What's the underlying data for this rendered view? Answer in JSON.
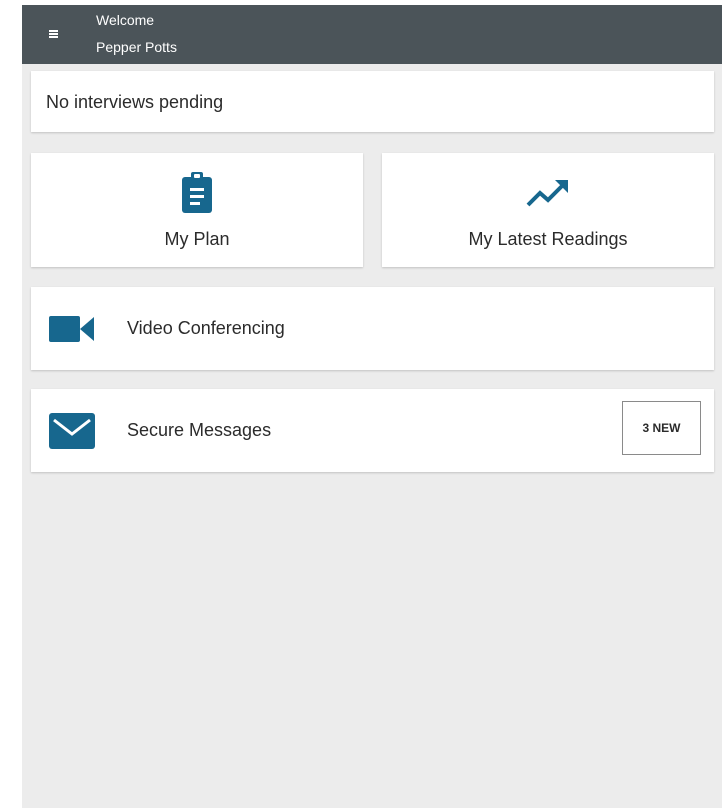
{
  "header": {
    "greeting": "Welcome",
    "user_name": "Pepper Potts",
    "menu_icon": "hamburger-menu-icon"
  },
  "status": {
    "text": "No interviews pending"
  },
  "tiles": [
    {
      "label": "My Plan",
      "icon": "clipboard-icon"
    },
    {
      "label": "My Latest Readings",
      "icon": "trending-up-icon"
    }
  ],
  "rows": [
    {
      "label": "Video Conferencing",
      "icon": "video-camera-icon"
    },
    {
      "label": "Secure Messages",
      "icon": "envelope-icon",
      "badge": "3 NEW"
    }
  ],
  "colors": {
    "app_bar": "#4b5459",
    "accent": "#17678e",
    "background": "#ececec",
    "card": "#ffffff"
  }
}
